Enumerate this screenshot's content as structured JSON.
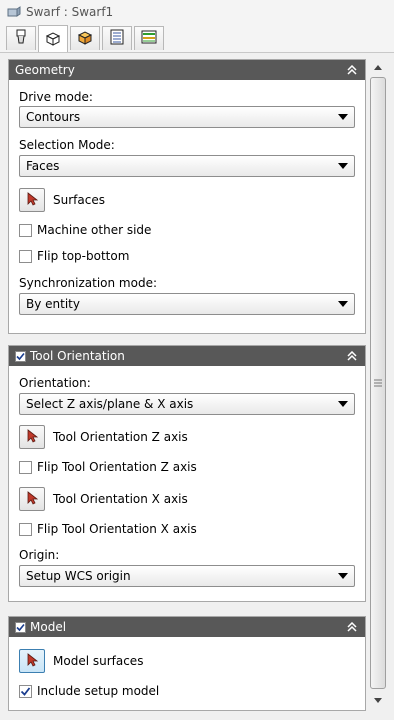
{
  "window": {
    "title": "Swarf : Swarf1"
  },
  "tabs": [
    {
      "icon": "tool-icon",
      "active": false
    },
    {
      "icon": "geometry-box-icon",
      "active": true
    },
    {
      "icon": "stock-box-icon",
      "active": false
    },
    {
      "icon": "parameters-list-icon",
      "active": false
    },
    {
      "icon": "levels-icon",
      "active": false
    }
  ],
  "geometry": {
    "header": "Geometry",
    "drive_mode_label": "Drive mode:",
    "drive_mode_value": "Contours",
    "selection_mode_label": "Selection Mode:",
    "selection_mode_value": "Faces",
    "surfaces_label": "Surfaces",
    "machine_other_side_label": "Machine other side",
    "machine_other_side_checked": false,
    "flip_top_bottom_label": "Flip top-bottom",
    "flip_top_bottom_checked": false,
    "sync_mode_label": "Synchronization mode:",
    "sync_mode_value": "By entity"
  },
  "tool_orientation": {
    "header": "Tool Orientation",
    "enabled": true,
    "orientation_label": "Orientation:",
    "orientation_value": "Select Z axis/plane & X axis",
    "z_axis_label": "Tool Orientation Z axis",
    "flip_z_label": "Flip Tool Orientation Z axis",
    "flip_z_checked": false,
    "x_axis_label": "Tool Orientation X axis",
    "flip_x_label": "Flip Tool Orientation X axis",
    "flip_x_checked": false,
    "origin_label": "Origin:",
    "origin_value": "Setup WCS origin"
  },
  "model": {
    "header": "Model",
    "enabled": true,
    "model_surfaces_label": "Model surfaces",
    "include_setup_label": "Include setup model",
    "include_setup_checked": true
  },
  "colors": {
    "section_header_bg": "#585858",
    "pick_arrow": "#c0392b",
    "selected_button": "#c9e5f7"
  }
}
